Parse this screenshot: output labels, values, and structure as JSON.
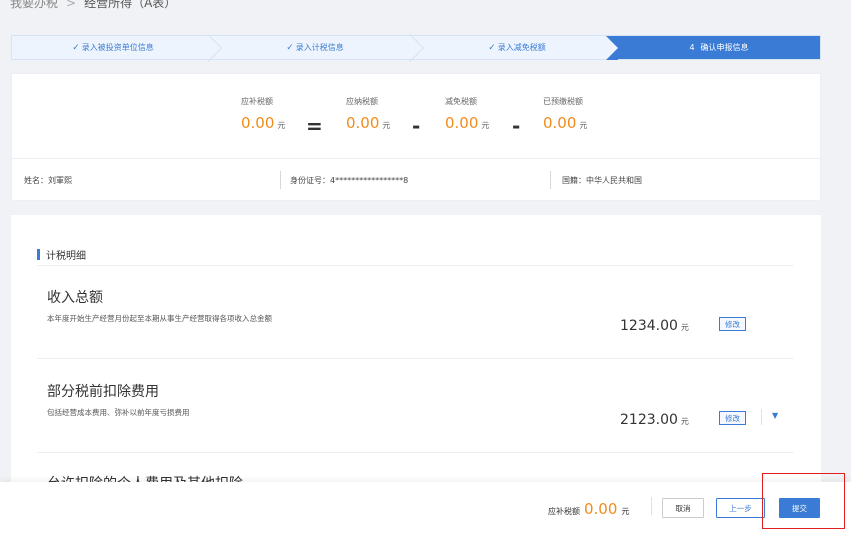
{
  "breadcrumb": {
    "parent": "我要办税",
    "current": "经营所得（A表）"
  },
  "steps": [
    {
      "label": "录入被投资单位信息",
      "done": true
    },
    {
      "label": "录入计税信息",
      "done": true
    },
    {
      "label": "录入减免税额",
      "done": true
    },
    {
      "num": "4",
      "label": "确认申报信息",
      "active": true
    }
  ],
  "summary": {
    "due": {
      "label": "应补税额",
      "value": "0.00",
      "unit": "元"
    },
    "payable": {
      "label": "应纳税额",
      "value": "0.00",
      "unit": "元"
    },
    "exempt": {
      "label": "减免税额",
      "value": "0.00",
      "unit": "元"
    },
    "prepaid": {
      "label": "已预缴税额",
      "value": "0.00",
      "unit": "元"
    },
    "ops": {
      "eq": "=",
      "minus": "-"
    }
  },
  "info": {
    "name_label": "姓名：",
    "name": "刘軍熙",
    "id_label": "身份证号：",
    "id": "4*****************8",
    "nationality_label": "国籍：",
    "nationality": "中华人民共和国"
  },
  "detail": {
    "section_title": "计税明细",
    "rows": [
      {
        "title": "收入总额",
        "desc": "本年度开始生产经营月份起至本期从事生产经营取得各项收入总金额",
        "amount": "1234.00",
        "unit": "元",
        "edit": "修改"
      },
      {
        "title": "部分税前扣除费用",
        "desc": "包括经营成本费用、弥补以前年度亏损费用",
        "amount": "2123.00",
        "unit": "元",
        "edit": "修改"
      }
    ],
    "partial_title": "允许扣除的个人费用及其他扣除"
  },
  "footer": {
    "due_label": "应补税额",
    "due_value": "0.00",
    "due_unit": "元",
    "cancel": "取消",
    "prev": "上一步",
    "submit": "提交"
  },
  "colors": {
    "accent": "#3a7bd5",
    "amount": "#f08c1a",
    "highlight": "#e02020"
  }
}
